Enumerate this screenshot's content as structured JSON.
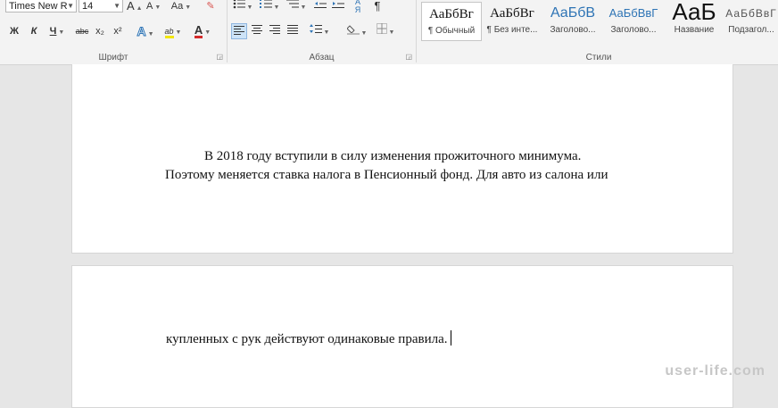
{
  "ribbon": {
    "font_group": {
      "label": "Шрифт",
      "font_name": "Times New R",
      "font_size": "14",
      "grow_label": "A",
      "shrink_label": "A",
      "case_label": "Aa",
      "clear_label": "✎",
      "bold": "Ж",
      "italic": "К",
      "underline": "Ч",
      "strike": "abc",
      "subscript": "x₂",
      "superscript": "x²",
      "effects": "A",
      "highlight": "ab",
      "font_color": "A"
    },
    "paragraph_group": {
      "label": "Абзац",
      "pilcrow": "¶"
    },
    "styles_group": {
      "label": "Стили",
      "items": [
        {
          "sample": "АаБбВг",
          "name": "¶ Обычный"
        },
        {
          "sample": "АаБбВг",
          "name": "¶ Без инте..."
        },
        {
          "sample": "АаБбВ",
          "name": "Заголово..."
        },
        {
          "sample": "АаБбВвГ",
          "name": "Заголово..."
        },
        {
          "sample": "АаБ",
          "name": "Название"
        },
        {
          "sample": "АаБбВвГ",
          "name": "Подзагол..."
        }
      ]
    }
  },
  "document": {
    "page1": {
      "line1": "В 2018 году вступили в силу изменения прожиточного минимума.",
      "line2": "Поэтому меняется ставка налога в Пенсионный фонд. Для авто из салона или"
    },
    "page2": {
      "line1": "купленных с рук действуют одинаковые правила."
    }
  },
  "watermark": "user-life.com",
  "colors": {
    "highlight": "#f2e600",
    "font_color": "#d42a2a",
    "heading_blue": "#2e74b5"
  }
}
